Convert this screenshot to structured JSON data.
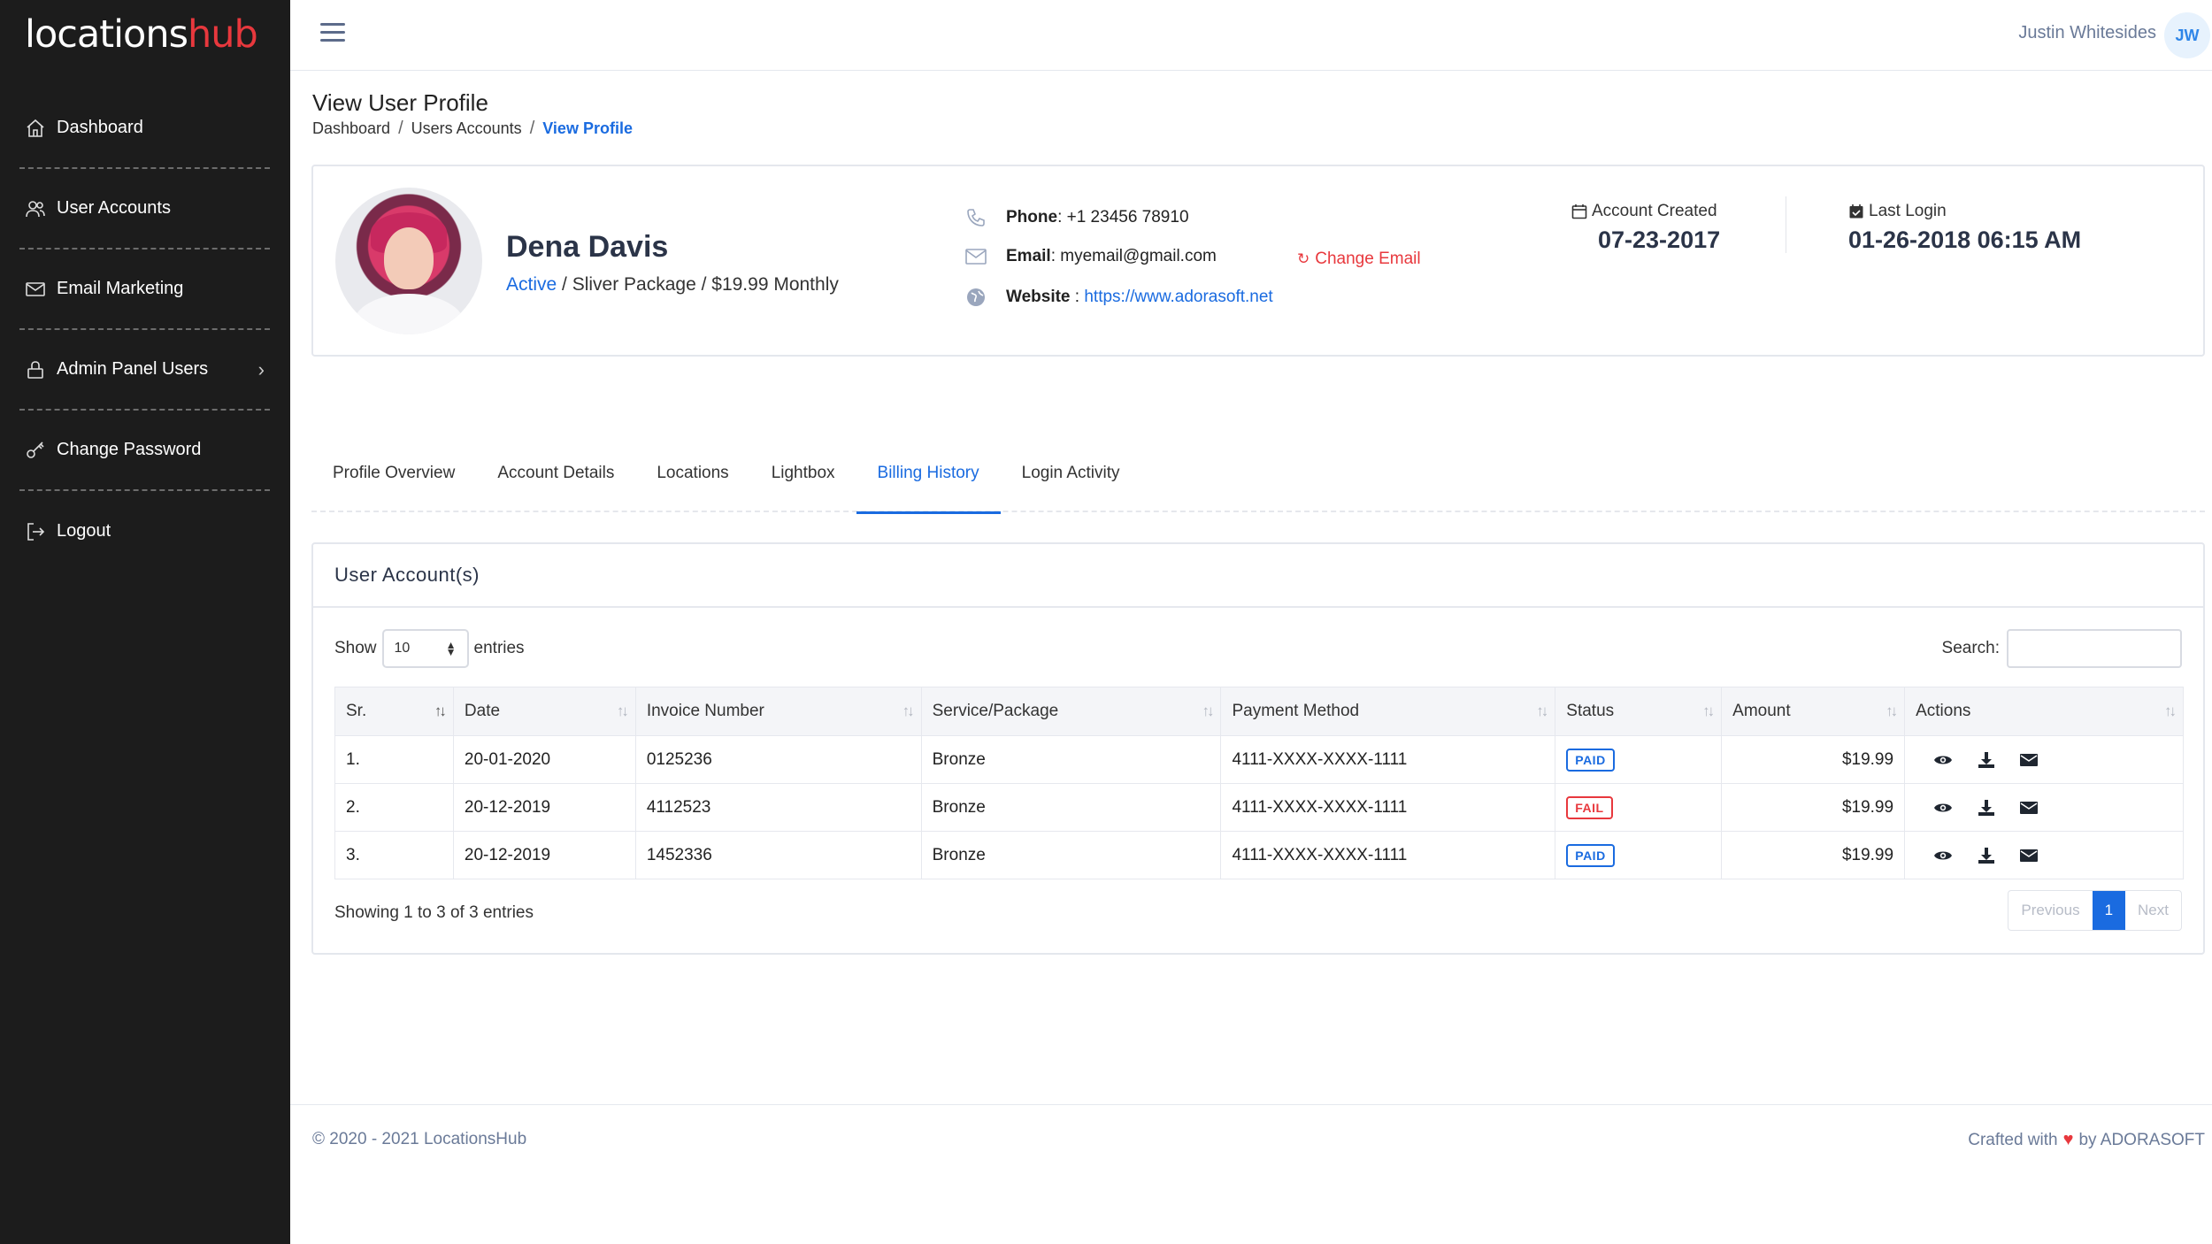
{
  "brand": {
    "part1": "locations",
    "part2": "hub"
  },
  "sidebar": {
    "items": [
      {
        "label": "Dashboard",
        "icon": "home-icon"
      },
      {
        "label": "User Accounts",
        "icon": "users-icon"
      },
      {
        "label": "Email Marketing",
        "icon": "mail-icon"
      },
      {
        "label": "Admin Panel Users",
        "icon": "lock-icon"
      },
      {
        "label": "Change Password",
        "icon": "key-icon"
      },
      {
        "label": "Logout",
        "icon": "logout-icon"
      }
    ]
  },
  "topbar": {
    "user_name": "Justin Whitesides",
    "initials": "JW"
  },
  "page": {
    "title": "View User Profile",
    "breadcrumb": [
      "Dashboard",
      "Users Accounts",
      "View Profile"
    ]
  },
  "profile": {
    "name": "Dena Davis",
    "status": "Active",
    "package": " / Sliver Package / $19.99 Monthly",
    "phone_label": "Phone",
    "phone": " : +1 23456 78910",
    "email_label": "Email",
    "email": " : myemail@gmail.com",
    "change_email": "Change Email",
    "website_label": "Website",
    "website_sep": " : ",
    "website": "https://www.adorasoft.net",
    "account_created_label": "Account Created",
    "account_created": "07-23-2017",
    "last_login_label": "Last Login",
    "last_login": "01-26-2018 06:15 AM"
  },
  "tabs": [
    {
      "label": "Profile Overview"
    },
    {
      "label": "Account Details"
    },
    {
      "label": "Locations"
    },
    {
      "label": "Lightbox"
    },
    {
      "label": "Billing History",
      "active": true
    },
    {
      "label": "Login Activity"
    }
  ],
  "table_card": {
    "title": "User Account(s)",
    "show_label": "Show",
    "entries_value": "10",
    "entries_label": "entries",
    "search_label": "Search:",
    "columns": [
      "Sr.",
      "Date",
      "Invoice Number",
      "Service/Package",
      "Payment Method",
      "Status",
      "Amount",
      "Actions"
    ],
    "rows": [
      {
        "sr": "1.",
        "date": "20-01-2020",
        "invoice": "0125236",
        "service": "Bronze",
        "payment": "4111-XXXX-XXXX-1111",
        "status": "PAID",
        "amount": "$19.99"
      },
      {
        "sr": "2.",
        "date": "20-12-2019",
        "invoice": "4112523",
        "service": "Bronze",
        "payment": "4111-XXXX-XXXX-1111",
        "status": "FAIL",
        "amount": "$19.99"
      },
      {
        "sr": "3.",
        "date": "20-12-2019",
        "invoice": "1452336",
        "service": "Bronze",
        "payment": "4111-XXXX-XXXX-1111",
        "status": "PAID",
        "amount": "$19.99"
      }
    ],
    "showing": "Showing 1 to 3 of 3 entries",
    "pager": {
      "previous": "Previous",
      "current": "1",
      "next": "Next"
    }
  },
  "footer": {
    "copyright": "© 2020 - 2021 LocationsHub",
    "crafted_prefix": "Crafted with",
    "crafted_suffix": "by ADORASOFT"
  },
  "colors": {
    "sidebar_bg": "#1c1c1c",
    "accent": "#1a6be0",
    "danger": "#e8383d"
  }
}
